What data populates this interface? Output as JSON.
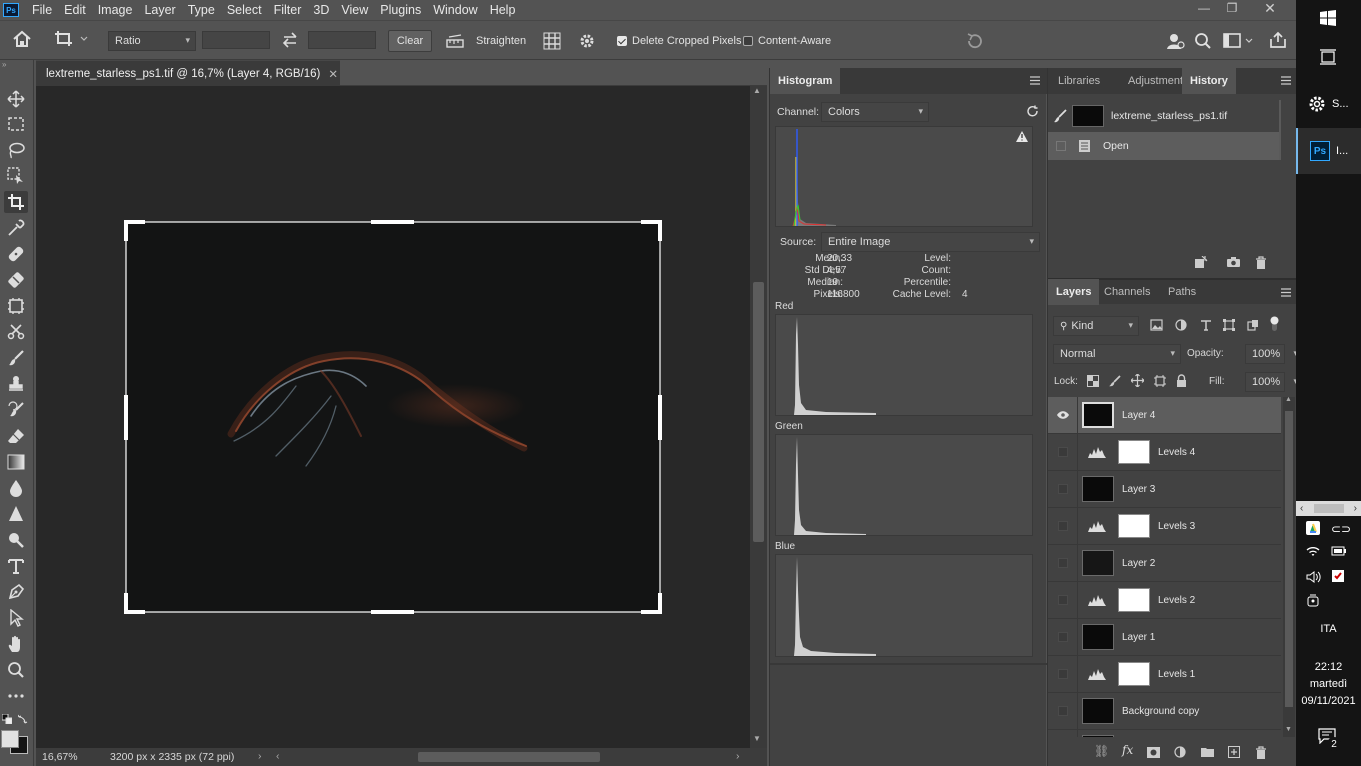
{
  "app": {
    "logo": "Ps"
  },
  "menu": [
    "File",
    "Edit",
    "Image",
    "Layer",
    "Type",
    "Select",
    "Filter",
    "3D",
    "View",
    "Plugins",
    "Window",
    "Help"
  ],
  "options_bar": {
    "ratio_select": "Ratio",
    "clear_label": "Clear",
    "straighten_label": "Straighten",
    "delete_cropped_label": "Delete Cropped Pixels",
    "delete_cropped_checked": true,
    "content_aware_label": "Content-Aware",
    "content_aware_checked": false
  },
  "document": {
    "tab_title": "lextreme_starless_ps1.tif @ 16,7% (Layer 4, RGB/16)",
    "zoom": "16,67%",
    "doc_info": "3200 px x 2335 px (72 ppi)"
  },
  "histogram_panel": {
    "tab": "Histogram",
    "channel_label": "Channel:",
    "channel_value": "Colors",
    "source_label": "Source:",
    "source_value": "Entire Image",
    "stats": {
      "mean_label": "Mean:",
      "mean": "20,33",
      "stddev_label": "Std Dev:",
      "stddev": "4,57",
      "median_label": "Median:",
      "median": "19",
      "pixels_label": "Pixels:",
      "pixels": "116800",
      "level_label": "Level:",
      "level": "",
      "count_label": "Count:",
      "count": "",
      "percentile_label": "Percentile:",
      "percentile": "",
      "cache_label": "Cache Level:",
      "cache": "4"
    },
    "channels": [
      "Red",
      "Green",
      "Blue"
    ]
  },
  "top_right_panel": {
    "tabs": [
      "Libraries",
      "Adjustments",
      "History"
    ],
    "active_tab": "History",
    "snapshot_name": "lextreme_starless_ps1.tif",
    "history_items": [
      "Open"
    ]
  },
  "layers_panel": {
    "tabs": [
      "Layers",
      "Channels",
      "Paths"
    ],
    "filter_kind": "Kind",
    "blend_mode": "Normal",
    "opacity_label": "Opacity:",
    "opacity": "100%",
    "lock_label": "Lock:",
    "fill_label": "Fill:",
    "fill": "100%",
    "layers": [
      {
        "name": "Layer 4",
        "type": "pixel",
        "visible": true,
        "selected": true
      },
      {
        "name": "Levels 4",
        "type": "levels",
        "visible": false
      },
      {
        "name": "Layer 3",
        "type": "pixel",
        "visible": false
      },
      {
        "name": "Levels 3",
        "type": "levels",
        "visible": false
      },
      {
        "name": "Layer 2",
        "type": "pixel",
        "visible": false
      },
      {
        "name": "Levels 2",
        "type": "levels",
        "visible": false
      },
      {
        "name": "Layer 1",
        "type": "pixel",
        "visible": false
      },
      {
        "name": "Levels 1",
        "type": "levels",
        "visible": false
      },
      {
        "name": "Background copy",
        "type": "pixel",
        "visible": false
      }
    ]
  },
  "taskbar": {
    "item_settings": "S...",
    "item_ps": "I...",
    "language": "ITA",
    "time": "22:12",
    "day": "martedì",
    "date": "09/11/2021",
    "notifications": "2"
  },
  "colors": {
    "accent": "#31a8ff",
    "panel": "#424242",
    "bg": "#535353"
  }
}
